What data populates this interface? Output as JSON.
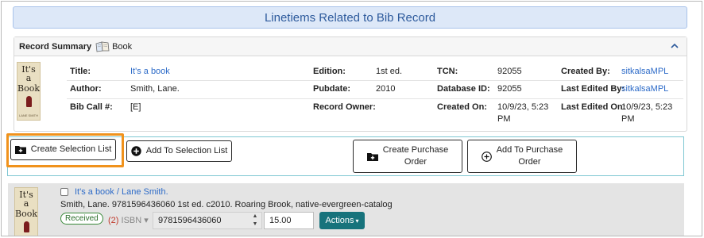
{
  "banner": {
    "title": "Linetiems Related to Bib Record"
  },
  "summary": {
    "header_label": "Record Summary",
    "format": "Book",
    "cover": {
      "line1": "It's",
      "line2": "a",
      "line3": "Book",
      "author_small": "LANE SMITH"
    },
    "col1": [
      {
        "key": "Title:",
        "value": "It's a book",
        "link": true
      },
      {
        "key": "Author:",
        "value": "Smith, Lane.",
        "link": false
      },
      {
        "key": "Bib Call #:",
        "value": "[E]",
        "link": false
      }
    ],
    "col2": [
      {
        "key": "Edition:",
        "value": "1st ed."
      },
      {
        "key": "Pubdate:",
        "value": "2010"
      },
      {
        "key": "Record Owner:",
        "value": ""
      }
    ],
    "col3": [
      {
        "key": "TCN:",
        "value": "92055"
      },
      {
        "key": "Database ID:",
        "value": "92055"
      },
      {
        "key": "Created On:",
        "value_line1": "10/9/23, 5:23",
        "value_line2": "PM"
      }
    ],
    "col4": [
      {
        "key": "Created By:",
        "value": "sitkalsaMPL",
        "link": true
      },
      {
        "key": "Last Edited By:",
        "value": "sitkalsaMPL",
        "link": true
      },
      {
        "key": "Last Edited On:",
        "value_line1": "10/9/23, 5:23",
        "value_line2": "PM"
      }
    ]
  },
  "actions": {
    "create_selection_list": "Create Selection List",
    "add_to_selection_list": "Add To Selection List",
    "create_po_line1": "Create Purchase",
    "create_po_line2": "Order",
    "add_po_line1": "Add To Purchase",
    "add_po_line2": "Order"
  },
  "lineitem": {
    "title_link": "It's a book / Lane Smith.",
    "details": "Smith, Lane. 9781596436060 1st ed. c2010. Roaring Brook, native-evergreen-catalog",
    "status_badge": "Received",
    "isbn_count": "(2)",
    "isbn_label": "ISBN",
    "isbn_value": "9781596436060",
    "price_value": "15.00",
    "actions_label": "Actions"
  },
  "colors": {
    "link": "#2d6bc8",
    "banner_bg": "#dde8f8",
    "highlight": "#f0921c",
    "actions_btn": "#17737c",
    "received": "#3a8a3a"
  }
}
